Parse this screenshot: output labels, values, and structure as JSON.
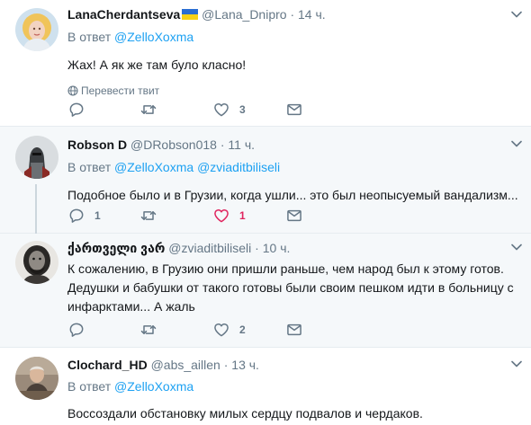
{
  "tweets": [
    {
      "name": "LanaCherdantseva",
      "handle": "@Lana_Dnipro",
      "dot": "·",
      "time": "14 ч.",
      "reply_prefix": "В ответ",
      "mentions": [
        "@ZelloXoxma"
      ],
      "text": "Жах! А як же там було класно!",
      "translate": "Перевести твит",
      "replies": "",
      "retweets": "",
      "likes": "3",
      "liked": false
    },
    {
      "name": "Robson D",
      "handle": "@DRobson018",
      "dot": "·",
      "time": "11 ч.",
      "reply_prefix": "В ответ",
      "mentions": [
        "@ZelloXoxma",
        "@zviaditbiliseli"
      ],
      "text": "Подобное было и в Грузии, когда ушли... это был неопысуемый вандализм...",
      "replies": "1",
      "retweets": "",
      "likes": "1",
      "liked": true
    },
    {
      "name": "ქართველი ვარ",
      "handle": "@zviaditbiliseli",
      "dot": "·",
      "time": "10 ч.",
      "text_lines": [
        "К сожалению, в Грузию они пришли раньше, чем народ был к этому готов.",
        "Дедушки и бабушки от такого готовы были своим пешком идти в больницу с",
        "инфарктами... А жаль"
      ],
      "replies": "",
      "retweets": "",
      "likes": "2",
      "liked": false
    },
    {
      "name": "Clochard_HD",
      "handle": "@abs_aillen",
      "dot": "·",
      "time": "13 ч.",
      "reply_prefix": "В ответ",
      "mentions": [
        "@ZelloXoxma"
      ],
      "text": "Воссоздали обстановку милых сердцу подвалов и чердаков."
    }
  ],
  "colors": {
    "accent": "#1da1f2",
    "muted": "#657786",
    "like": "#e0245e",
    "highlight_bg": "#f5f8fa"
  },
  "icons": [
    "chevron-down-icon",
    "globe-icon",
    "reply-icon",
    "retweet-icon",
    "heart-icon",
    "dm-icon",
    "ukraine-flag-icon"
  ]
}
